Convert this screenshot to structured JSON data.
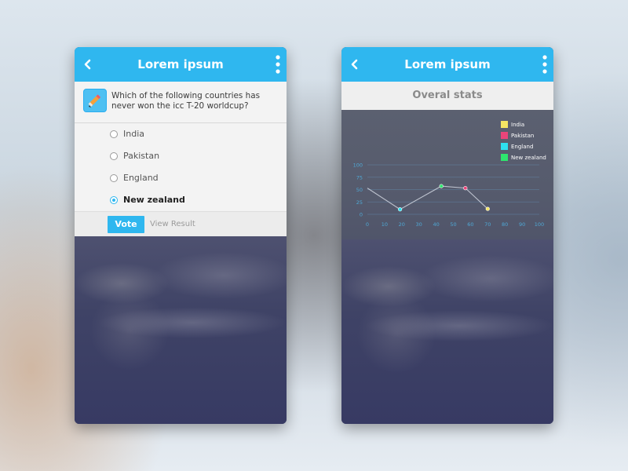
{
  "left_screen": {
    "header": {
      "title": "Lorem ipsum"
    },
    "question": {
      "text": "Which of the following countries has never won the icc T-20 worldcup?"
    },
    "options": [
      {
        "label": "India",
        "selected": false
      },
      {
        "label": "Pakistan",
        "selected": false
      },
      {
        "label": "England",
        "selected": false
      },
      {
        "label": "New zealand",
        "selected": true
      }
    ],
    "actions": {
      "vote_label": "Vote",
      "view_result_label": "View Result"
    }
  },
  "right_screen": {
    "header": {
      "title": "Lorem ipsum"
    },
    "stats_title": "Overal stats"
  },
  "colors": {
    "accent": "#2fb7ef",
    "header_text": "#ffffff"
  },
  "chart_data": {
    "type": "line",
    "legend": [
      {
        "name": "India",
        "color": "#f5e663"
      },
      {
        "name": "Pakistan",
        "color": "#e8457a"
      },
      {
        "name": "England",
        "color": "#2ee0f0"
      },
      {
        "name": "New zealand",
        "color": "#2ee66e"
      }
    ],
    "legend_position": "top-right",
    "x_ticks": [
      0,
      10,
      20,
      30,
      40,
      50,
      60,
      70,
      80,
      90,
      100
    ],
    "y_ticks": [
      0,
      25,
      50,
      75,
      100
    ],
    "xlim": [
      0,
      100
    ],
    "ylim": [
      0,
      100
    ],
    "grid": true,
    "series": [
      {
        "points": [
          {
            "x": 0,
            "y": 53,
            "color": ""
          },
          {
            "x": 19,
            "y": 10,
            "color": "#2ee0f0"
          },
          {
            "x": 43,
            "y": 57,
            "color": "#2ee66e"
          },
          {
            "x": 57,
            "y": 53,
            "color": "#e8457a"
          },
          {
            "x": 70,
            "y": 11,
            "color": "#f5e663"
          }
        ]
      }
    ]
  }
}
